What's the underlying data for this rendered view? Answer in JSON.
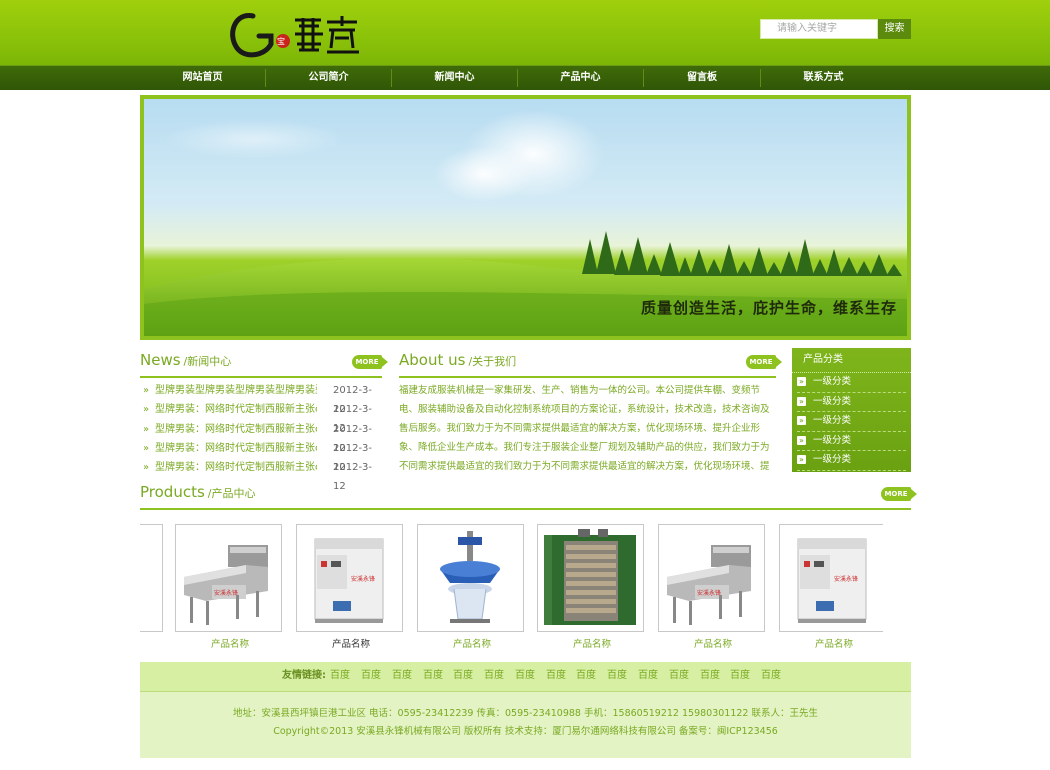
{
  "header": {
    "logo_text": "G寶盆",
    "search_placeholder": "请输入关键字",
    "search_button": "搜索"
  },
  "nav": [
    "网站首页",
    "公司简介",
    "新闻中心",
    "产品中心",
    "留言板",
    "联系方式"
  ],
  "banner": {
    "slogan": "质量创造生活，庇护生命，维系生存"
  },
  "news": {
    "title_en": "News",
    "title_cn": "/新闻中心",
    "more": "MORE",
    "items": [
      {
        "title": "型牌男装型牌男装型牌男装型牌男装型",
        "date": "2012-3-12"
      },
      {
        "title": "型牌男装：网络时代定制西服新主张c",
        "date": "2012-3-12"
      },
      {
        "title": "型牌男装：网络时代定制西服新主张c",
        "date": "2012-3-12"
      },
      {
        "title": "型牌男装：网络时代定制西服新主张c",
        "date": "2012-3-12"
      },
      {
        "title": "型牌男装：网络时代定制西服新主张c",
        "date": "2012-3-12"
      }
    ]
  },
  "about": {
    "title_en": "About us",
    "title_cn": "/关于我们",
    "more": "MORE",
    "text": "福建友成服装机械是一家集研发、生产、销售为一体的公司。本公司提供车棚、变频节电、服装辅助设备及自动化控制系统项目的方案论证，系统设计，技术改造，技术咨询及售后服务。我们致力于为不同需求提供最适宜的解决方案，优化现场环境、提升企业形象、降低企业生产成本。我们专注于服装企业整厂规划及辅助产品的供应，我们致力于为不同需求提供最适宜的我们致力于为不同需求提供最适宜的解决方案，优化现场环境、提升企业形象、降"
  },
  "categories": {
    "title": "产品分类",
    "items": [
      "一级分类",
      "一级分类",
      "一级分类",
      "一级分类",
      "一级分类"
    ]
  },
  "products": {
    "title_en": "Products",
    "title_cn": "/产品中心",
    "more": "MORE",
    "items": [
      {
        "name": "产品名称",
        "image": "screening-machine"
      },
      {
        "name": "产品名称",
        "image": "cabinet-machine"
      },
      {
        "name": "产品名称",
        "image": "vibrating-sieve"
      },
      {
        "name": "产品名称",
        "image": "drying-oven"
      },
      {
        "name": "产品名称",
        "image": "screening-machine"
      },
      {
        "name": "产品名称",
        "image": "cabinet-machine"
      }
    ]
  },
  "friend_links": {
    "label": "友情链接:",
    "items": [
      "百度",
      "百度",
      "百度",
      "百度",
      "百度",
      "百度",
      "百度",
      "百度",
      "百度",
      "百度",
      "百度",
      "百度",
      "百度",
      "百度",
      "百度"
    ]
  },
  "footer": {
    "line1": "地址：安溪县西坪镇巨港工业区 电话：0595-23412239 传真：0595-23410988 手机：15860519212 15980301122 联系人：王先生",
    "line2": "Copyright©2013 安溪县永锋机械有限公司 版权所有 技术支持：厦门易尔通网络科技有限公司 备案号：闽ICP123456"
  },
  "colors": {
    "brand_green": "#8dc21f",
    "dark_green": "#3f6b09",
    "text_green": "#7aa922"
  }
}
